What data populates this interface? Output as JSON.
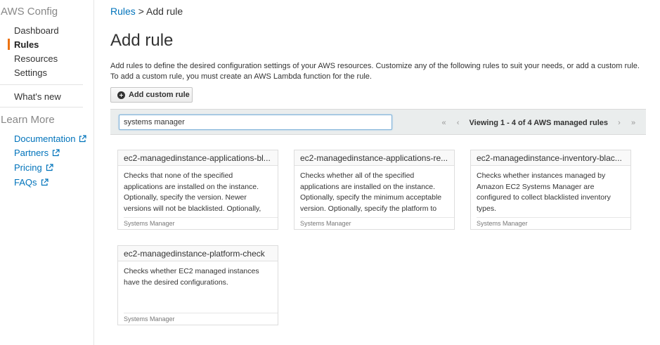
{
  "sidebar": {
    "title": "AWS Config",
    "items": [
      {
        "label": "Dashboard"
      },
      {
        "label": "Rules"
      },
      {
        "label": "Resources"
      },
      {
        "label": "Settings"
      }
    ],
    "whats_new": "What's new",
    "learn_more_title": "Learn More",
    "links": [
      {
        "label": "Documentation",
        "icon": "external-link-icon"
      },
      {
        "label": "Partners",
        "icon": "external-link-icon"
      },
      {
        "label": "Pricing",
        "icon": "external-link-icon"
      },
      {
        "label": "FAQs",
        "icon": "external-link-icon"
      }
    ],
    "accent_color": "#ec7211"
  },
  "breadcrumb": {
    "parent": "Rules",
    "separator": ">",
    "current": "Add rule"
  },
  "page": {
    "title": "Add rule",
    "intro": "Add rules to define the desired configuration settings of your AWS resources. Customize any of the following rules to suit your needs, or add a custom rule. To add a custom rule, you must create an AWS Lambda function for the rule.",
    "add_button": "Add custom rule"
  },
  "search": {
    "value": "systems manager"
  },
  "pager": {
    "first": "«",
    "prev": "‹",
    "viewing": "Viewing 1 - 4 of 4 AWS managed rules",
    "next": "›",
    "last": "»"
  },
  "rules": [
    {
      "title": "ec2-managedinstance-applications-bl...",
      "description": "Checks that none of the specified applications are installed on the instance. Optionally, specify the version. Newer versions will not be blacklisted. Optionally,",
      "source": "Systems Manager"
    },
    {
      "title": "ec2-managedinstance-applications-re...",
      "description": "Checks whether all of the specified applications are installed on the instance. Optionally, specify the minimum acceptable version. Optionally, specify the platform to",
      "source": "Systems Manager"
    },
    {
      "title": "ec2-managedinstance-inventory-blac...",
      "description": "Checks whether instances managed by Amazon EC2 Systems Manager are configured to collect blacklisted inventory types.",
      "source": "Systems Manager"
    },
    {
      "title": "ec2-managedinstance-platform-check",
      "description": "Checks whether EC2 managed instances have the desired configurations.",
      "source": "Systems Manager"
    }
  ]
}
